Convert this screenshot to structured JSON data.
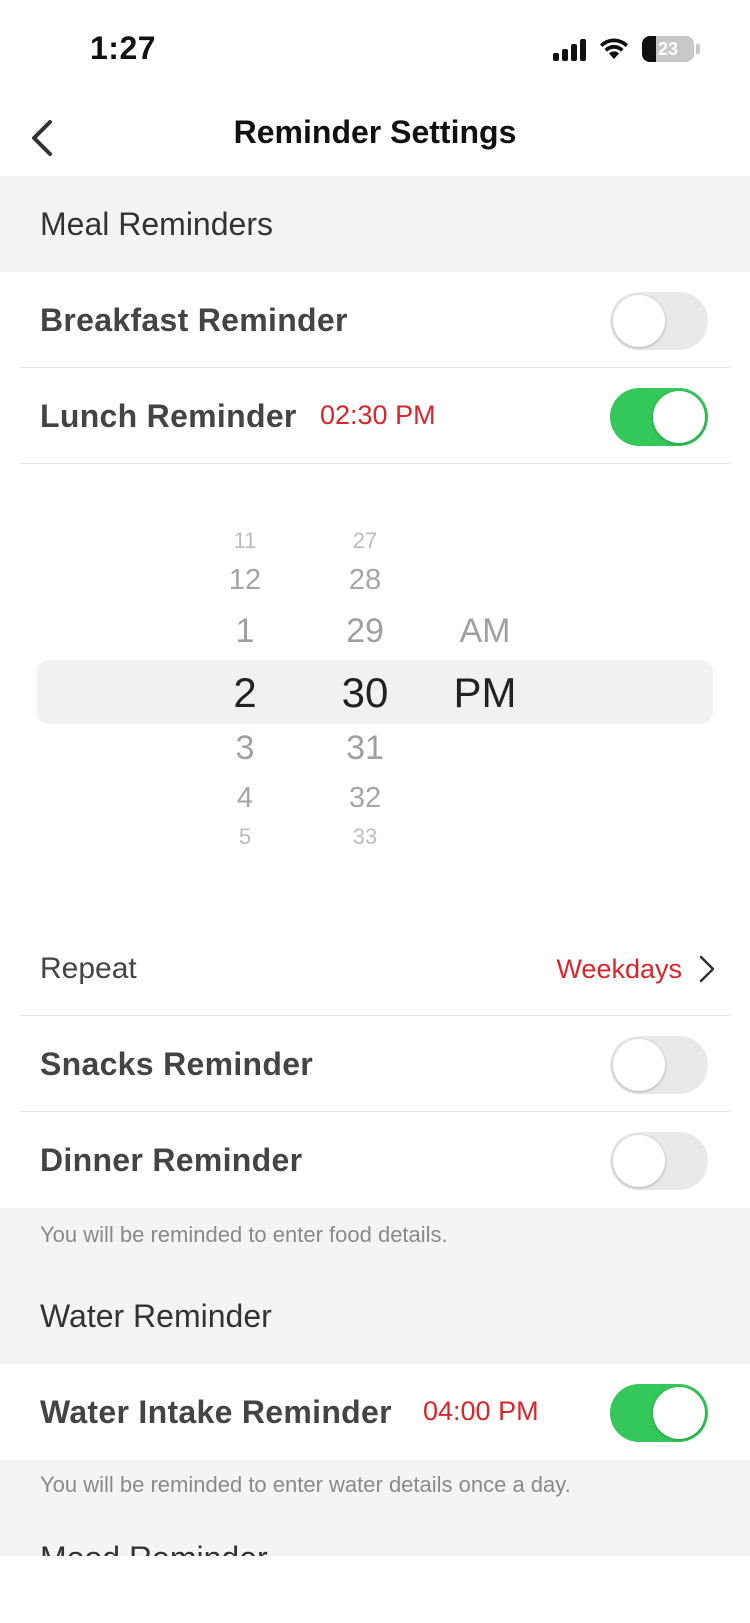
{
  "status_bar": {
    "time": "1:27",
    "battery": "23"
  },
  "nav": {
    "title": "Reminder Settings"
  },
  "meal_section": {
    "header": "Meal Reminders",
    "breakfast": {
      "label": "Breakfast Reminder",
      "enabled": false
    },
    "lunch": {
      "label": "Lunch Reminder",
      "time": "02:30 PM",
      "enabled": true
    },
    "picker": {
      "hours": [
        "11",
        "12",
        "1",
        "2",
        "3",
        "4",
        "5"
      ],
      "minutes": [
        "27",
        "28",
        "29",
        "30",
        "31",
        "32",
        "33"
      ],
      "periods": [
        "AM",
        "PM"
      ],
      "selected": {
        "hour": "2",
        "minute": "30",
        "period": "PM"
      }
    },
    "repeat": {
      "label": "Repeat",
      "value": "Weekdays"
    },
    "snacks": {
      "label": "Snacks Reminder",
      "enabled": false
    },
    "dinner": {
      "label": "Dinner Reminder",
      "enabled": false
    },
    "footnote": "You will be reminded to enter food details."
  },
  "water_section": {
    "header": "Water Reminder",
    "intake": {
      "label": "Water Intake Reminder",
      "time": "04:00 PM",
      "enabled": true
    },
    "footnote": "You will be reminded to enter water details once a day."
  },
  "next_section": {
    "header": "Mood Reminder"
  },
  "colors": {
    "accent_red": "#d9252b",
    "toggle_on": "#34c759",
    "toggle_off": "#e9e9e9"
  }
}
